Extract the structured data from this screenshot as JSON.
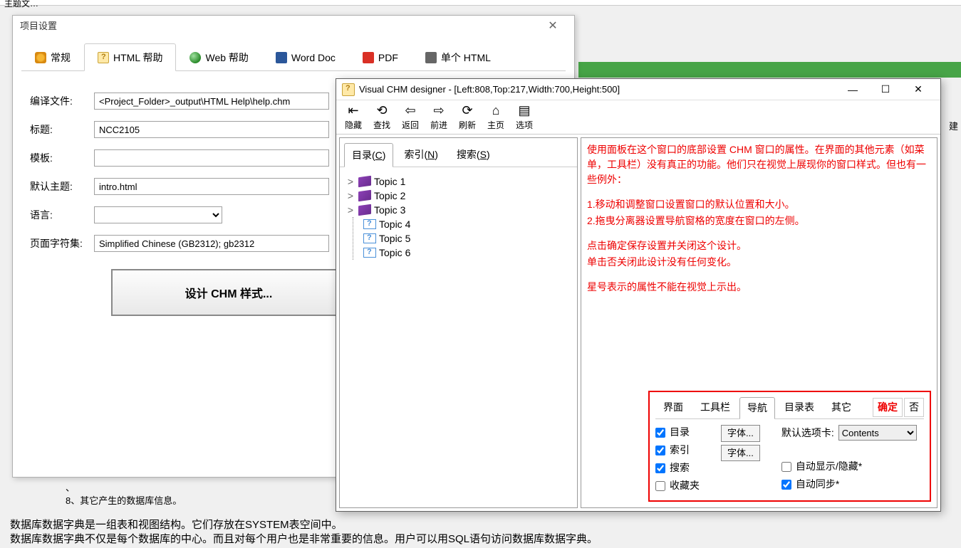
{
  "bg": {
    "frag_top": "主题文…",
    "item7": "、",
    "item8_num": "8、",
    "item8": "其它产生的数据库信息。",
    "para1": "数据库数据字典是一组表和视图结构。它们存放在SYSTEM表空间中。",
    "para2": "数据库数据字典不仅是每个数据库的中心。而且对每个用户也是非常重要的信息。用户可以用SQL语句访问数据库数据字典。",
    "right_char": "建"
  },
  "dlg1": {
    "title": "项目设置",
    "tabs": {
      "general": "常规",
      "htmlhelp": "HTML 帮助",
      "webhelp": "Web 帮助",
      "worddoc": "Word Doc",
      "pdf": "PDF",
      "singlehtml": "单个 HTML"
    },
    "labels": {
      "compile": "编译文件:",
      "title": "标题:",
      "template": "模板:",
      "default_topic": "默认主题:",
      "language": "语言:",
      "charset": "页面字符集:"
    },
    "values": {
      "compile": "<Project_Folder>_output\\HTML Help\\help.chm",
      "title": "NCC2105",
      "template": "",
      "default_topic": "intro.html",
      "language": "",
      "charset": "Simplified Chinese (GB2312); gb2312"
    },
    "button": "设计 CHM 样式..."
  },
  "dlg2": {
    "title": "Visual CHM designer - [Left:808,Top:217,Width:700,Height:500]",
    "toolbar": {
      "hide": "隐藏",
      "find": "查找",
      "back": "返回",
      "forward": "前进",
      "refresh": "刷新",
      "home": "主页",
      "options": "选项"
    },
    "navtabs": {
      "contents": "目录(C)",
      "contents_ul": "C",
      "contents_pre": "目录(",
      "contents_post": ")",
      "index": "索引(N)",
      "index_pre": "索引(",
      "index_ul": "N",
      "index_post": ")",
      "search": "搜索(S)",
      "search_pre": "搜索(",
      "search_ul": "S",
      "search_post": ")"
    },
    "tree": [
      {
        "label": "Topic 1",
        "type": "book",
        "exp": ">"
      },
      {
        "label": "Topic 2",
        "type": "book",
        "exp": ">"
      },
      {
        "label": "Topic 3",
        "type": "book",
        "exp": ">"
      },
      {
        "label": "Topic 4",
        "type": "page",
        "exp": ""
      },
      {
        "label": "Topic 5",
        "type": "page",
        "exp": ""
      },
      {
        "label": "Topic 6",
        "type": "page",
        "exp": ""
      }
    ],
    "redtext": {
      "p1": "使用面板在这个窗口的底部设置 CHM 窗口的属性。在界面的其他元素（如菜单，工具栏）没有真正的功能。他们只在视觉上展现你的窗口样式。但也有一些例外：",
      "p2": "1.移动和调整窗口设置窗口的默认位置和大小。",
      "p3": "2.拖曳分离器设置导航窗格的宽度在窗口的左侧。",
      "p4": "点击确定保存设置并关闭这个设计。",
      "p5": "单击否关闭此设计没有任何变化。",
      "p6": "星号表示的属性不能在视觉上示出。"
    },
    "props": {
      "tabs": {
        "jiemian": "界面",
        "gongjulan": "工具栏",
        "daohang": "导航",
        "mulubiao": "目录表",
        "qita": "其它"
      },
      "actions": {
        "ok": "确定",
        "no": "否"
      },
      "checks": {
        "mulu": "目录",
        "suoyin": "索引",
        "sousuo": "搜索",
        "shoucang": "收藏夹",
        "autoshow": "自动显示/隐藏*",
        "autosync": "自动同步*"
      },
      "fontbtn": "字体...",
      "default_tab_label": "默认选项卡:",
      "default_tab_value": "Contents"
    }
  }
}
